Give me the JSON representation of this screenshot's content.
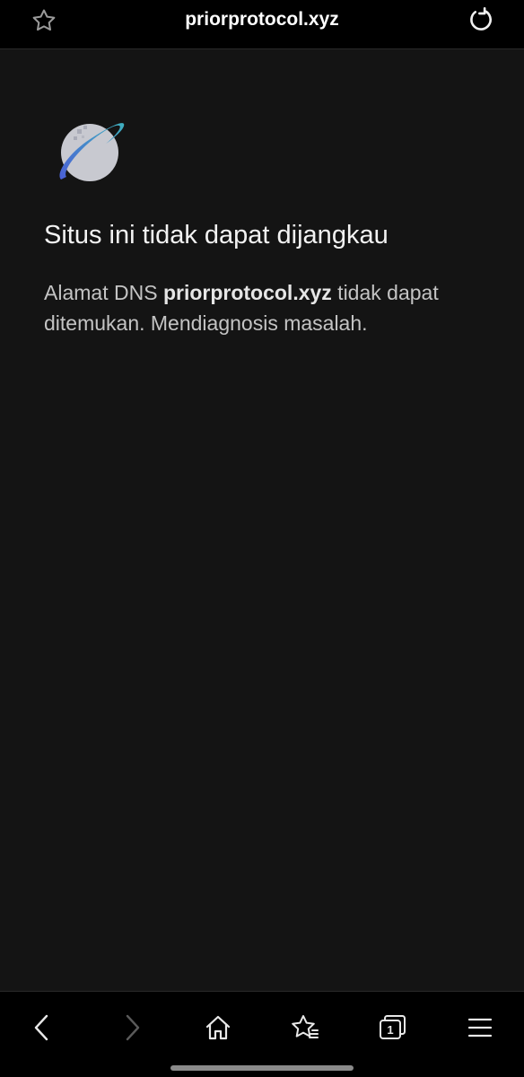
{
  "address_bar": {
    "url": "priorprotocol.xyz",
    "bookmark_icon": "star-outline-icon",
    "reload_icon": "reload-icon"
  },
  "error": {
    "icon": "globe-icon",
    "title": "Situs ini tidak dapat dijangkau",
    "desc_prefix": "Alamat DNS ",
    "desc_host": "priorprotocol.xyz",
    "desc_suffix": " tidak dapat ditemukan. Mendiagnosis masalah."
  },
  "toolbar": {
    "back_icon": "back-arrow-icon",
    "forward_icon": "forward-arrow-icon",
    "home_icon": "home-icon",
    "bookmarks_icon": "bookmark-star-icon",
    "tabs_icon": "tabs-icon",
    "tabs_count": "1",
    "menu_icon": "menu-icon"
  },
  "colors": {
    "background": "#141414",
    "bar": "#000000",
    "text_primary": "#f2f2f2",
    "text_secondary": "#c4c4c4",
    "globe_accent_teal": "#3aa6b9",
    "globe_accent_blue": "#4a5fd6"
  }
}
